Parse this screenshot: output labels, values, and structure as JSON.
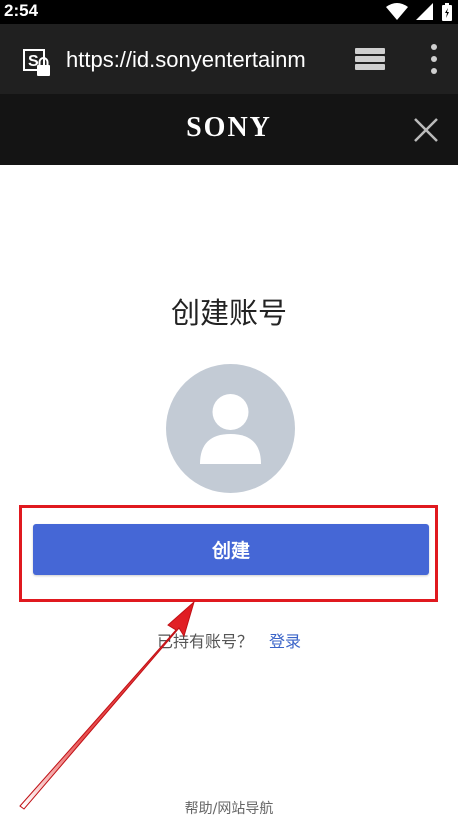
{
  "status_bar": {
    "time": "2:54",
    "icons": [
      "wifi-icon",
      "signal-icon",
      "battery-icon"
    ]
  },
  "browser": {
    "url": "https://id.sonyentertainm",
    "site_icon": "site-lock-icon",
    "tabs_icon": "tabs-icon",
    "menu_icon": "more-vert-icon"
  },
  "header": {
    "brand": "SONY",
    "close_icon": "close-icon"
  },
  "main": {
    "title": "创建账号",
    "avatar_icon": "user-avatar-icon",
    "create_label": "创建",
    "signin_prompt": "已持有账号？",
    "signin_link": "登录"
  },
  "footer": {
    "help_label": "帮助/网站导航"
  },
  "colors": {
    "primary_button": "#4567d6",
    "link": "#3a64c8",
    "annotation": "#e0191f",
    "header_bg": "#141414",
    "toolbar_bg": "#202020",
    "avatar_bg": "#c3cbd5"
  }
}
